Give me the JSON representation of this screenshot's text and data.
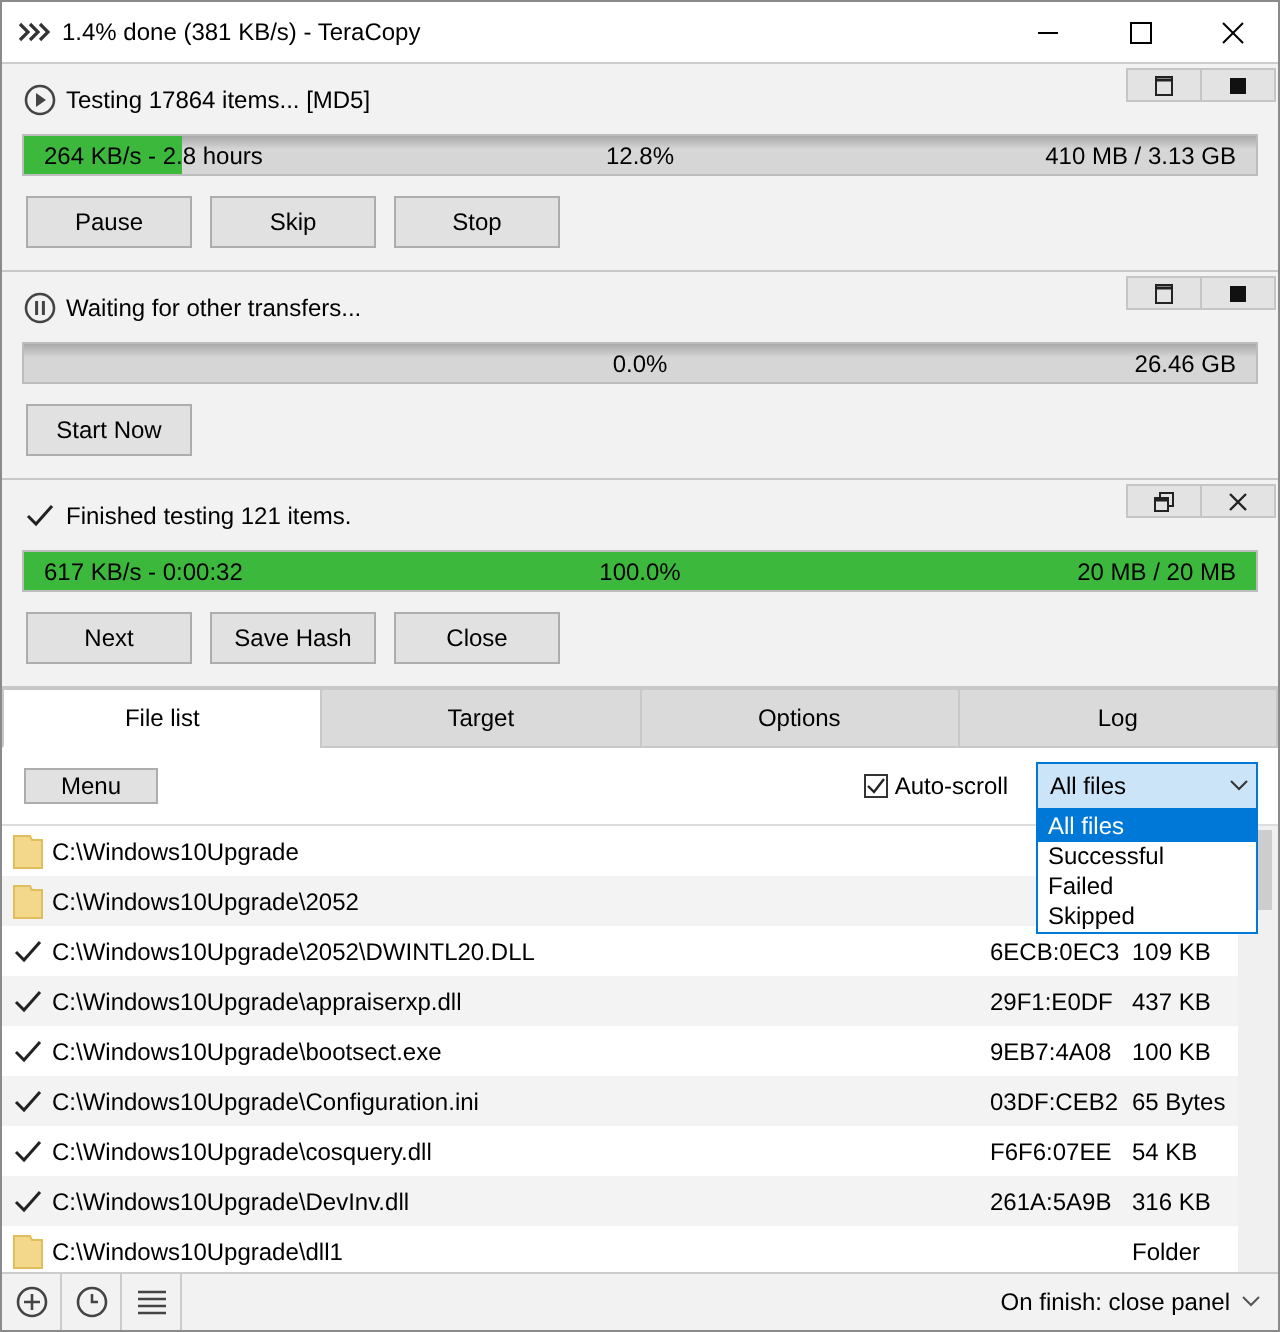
{
  "window": {
    "title": "1.4% done (381 KB/s) - TeraCopy"
  },
  "jobs": [
    {
      "kind": "running",
      "status": "Testing 17864 items... [MD5]",
      "corner_buttons": [
        {
          "kind": "window"
        },
        {
          "kind": "stop"
        }
      ],
      "progress": {
        "level": 0.128,
        "left": "264 KB/s - 2.8 hours",
        "center": "12.8%",
        "right": "410 MB / 3.13 GB"
      },
      "buttons": [
        "Pause",
        "Skip",
        "Stop"
      ]
    },
    {
      "kind": "waiting",
      "status": "Waiting for other transfers...",
      "corner_buttons": [
        {
          "kind": "window"
        },
        {
          "kind": "stop"
        }
      ],
      "progress": {
        "level": 0,
        "center": "0.0%",
        "right": "26.46 GB"
      },
      "buttons": [
        "Start Now"
      ]
    },
    {
      "kind": "done",
      "status": "Finished testing 121 items.",
      "corner_buttons": [
        {
          "kind": "restore"
        },
        {
          "kind": "close"
        }
      ],
      "progress": {
        "level": 1,
        "left": "617 KB/s - 0:00:32",
        "center": "100.0%",
        "right": "20 MB / 20 MB"
      },
      "buttons": [
        "Next",
        "Save Hash",
        "Close"
      ]
    }
  ],
  "tabs": [
    {
      "label": "File list",
      "selected": true
    },
    {
      "label": "Target",
      "selected": false
    },
    {
      "label": "Options",
      "selected": false
    },
    {
      "label": "Log",
      "selected": false
    }
  ],
  "toolbar": {
    "menu": "Menu",
    "auto_scroll": {
      "label": "Auto-scroll",
      "checked": true
    },
    "filter": {
      "value": "All files",
      "expanded": true,
      "options": [
        {
          "label": "All files",
          "selected": true
        },
        {
          "label": "Successful",
          "selected": false
        },
        {
          "label": "Failed",
          "selected": false
        },
        {
          "label": "Skipped",
          "selected": false
        }
      ]
    }
  },
  "files": [
    {
      "kind": "folder",
      "path": "C:\\Windows10Upgrade"
    },
    {
      "kind": "folder",
      "path": "C:\\Windows10Upgrade\\2052"
    },
    {
      "kind": "file",
      "path": "C:\\Windows10Upgrade\\2052\\DWINTL20.DLL",
      "hash": "6ECB:0EC3",
      "size": "109 KB"
    },
    {
      "kind": "file",
      "path": "C:\\Windows10Upgrade\\appraiserxp.dll",
      "hash": "29F1:E0DF",
      "size": "437 KB"
    },
    {
      "kind": "file",
      "path": "C:\\Windows10Upgrade\\bootsect.exe",
      "hash": "9EB7:4A08",
      "size": "100 KB"
    },
    {
      "kind": "file",
      "path": "C:\\Windows10Upgrade\\Configuration.ini",
      "hash": "03DF:CEB2",
      "size": "65 Bytes"
    },
    {
      "kind": "file",
      "path": "C:\\Windows10Upgrade\\cosquery.dll",
      "hash": "F6F6:07EE",
      "size": "54 KB"
    },
    {
      "kind": "file",
      "path": "C:\\Windows10Upgrade\\DevInv.dll",
      "hash": "261A:5A9B",
      "size": "316 KB"
    },
    {
      "kind": "folder",
      "path": "C:\\Windows10Upgrade\\dll1",
      "size": "Folder"
    }
  ],
  "status_bar": {
    "on_finish": "On finish: close panel"
  }
}
